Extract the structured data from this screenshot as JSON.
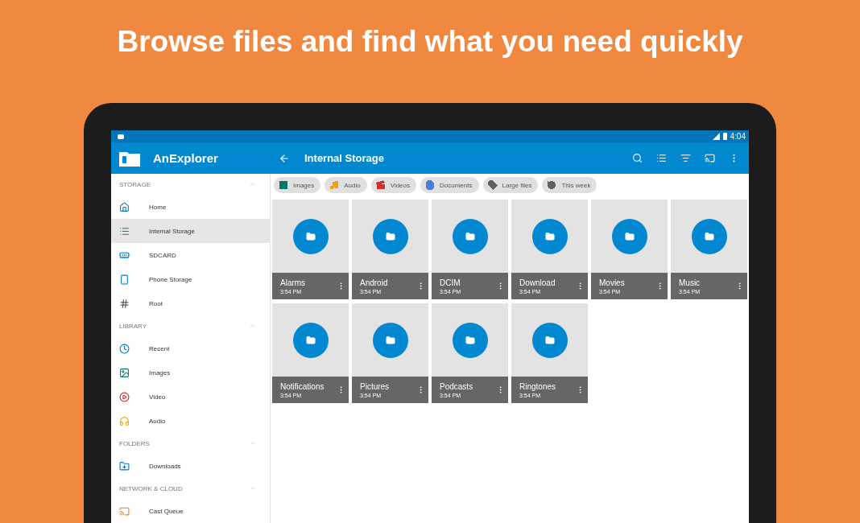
{
  "headline": "Browse files and find what you need quickly",
  "status_bar": {
    "time": "4:04"
  },
  "app_name": "AnExplorer",
  "toolbar": {
    "title": "Internal Storage"
  },
  "sidebar": {
    "sections": [
      {
        "title": "STORAGE",
        "expanded": true,
        "items": [
          {
            "label": "Home",
            "selected": false
          },
          {
            "label": "Internal Storage",
            "selected": true
          },
          {
            "label": "SDCARD",
            "selected": false
          },
          {
            "label": "Phone Storage",
            "selected": false
          },
          {
            "label": "Root",
            "selected": false
          }
        ]
      },
      {
        "title": "LIBRARY",
        "expanded": true,
        "items": [
          {
            "label": "Recent",
            "selected": false
          },
          {
            "label": "Images",
            "selected": false
          },
          {
            "label": "Video",
            "selected": false
          },
          {
            "label": "Audio",
            "selected": false
          }
        ]
      },
      {
        "title": "FOLDERS",
        "expanded": true,
        "items": [
          {
            "label": "Downloads",
            "selected": false
          }
        ]
      },
      {
        "title": "NETWORK & CLOUD",
        "expanded": true,
        "items": [
          {
            "label": "Cast Queue",
            "selected": false
          }
        ]
      }
    ]
  },
  "chips": [
    {
      "label": "Images",
      "color": "#00796b"
    },
    {
      "label": "Audio",
      "color": "#f0a30a"
    },
    {
      "label": "Videos",
      "color": "#d32f2f"
    },
    {
      "label": "Documents",
      "color": "#4a7fd8"
    },
    {
      "label": "Large files",
      "color": "#616161"
    },
    {
      "label": "This week",
      "color": "#616161"
    }
  ],
  "folders": [
    {
      "name": "Alarms",
      "time": "3:54 PM"
    },
    {
      "name": "Android",
      "time": "3:54 PM"
    },
    {
      "name": "DCIM",
      "time": "3:54 PM"
    },
    {
      "name": "Download",
      "time": "3:54 PM"
    },
    {
      "name": "Movies",
      "time": "3:54 PM"
    },
    {
      "name": "Music",
      "time": "3:54 PM"
    },
    {
      "name": "Notifications",
      "time": "3:54 PM"
    },
    {
      "name": "Pictures",
      "time": "3:54 PM"
    },
    {
      "name": "Podcasts",
      "time": "3:54 PM"
    },
    {
      "name": "Ringtones",
      "time": "3:54 PM"
    }
  ]
}
